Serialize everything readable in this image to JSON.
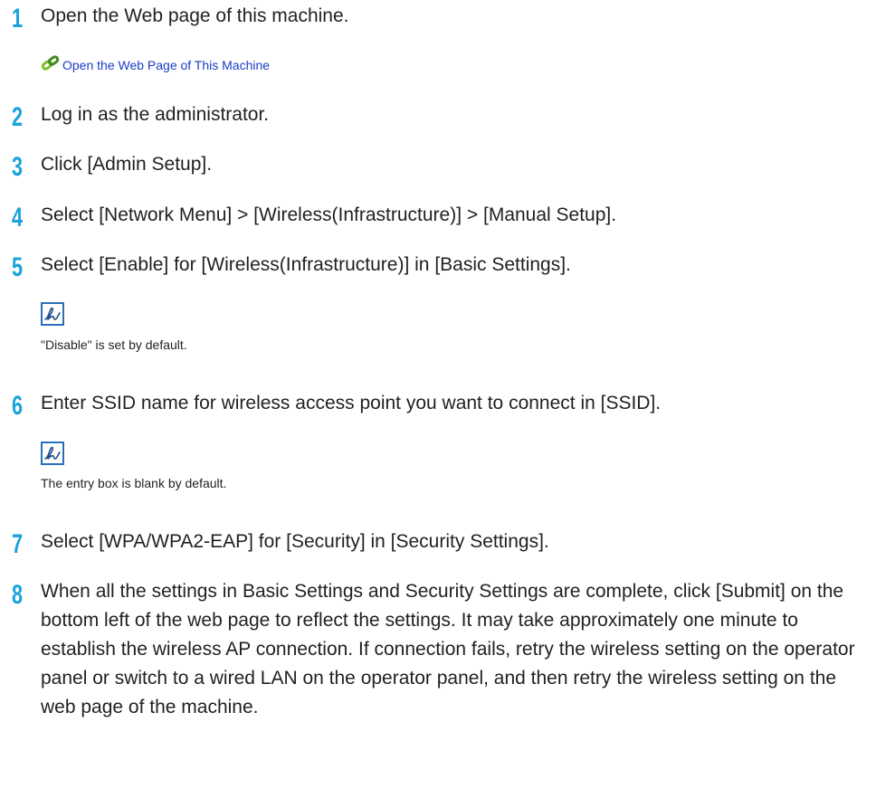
{
  "steps": [
    {
      "number": "1",
      "text": "Open the Web page of this machine."
    },
    {
      "number": "2",
      "text": "Log in as the administrator."
    },
    {
      "number": "3",
      "text": "Click [Admin Setup]."
    },
    {
      "number": "4",
      "text": "Select [Network Menu] > [Wireless(Infrastructure)] > [Manual Setup]."
    },
    {
      "number": "5",
      "text": "Select [Enable] for [Wireless(Infrastructure)] in [Basic Settings]."
    },
    {
      "number": "6",
      "text": "Enter SSID name for wireless access point you want to connect in [SSID]."
    },
    {
      "number": "7",
      "text": "Select [WPA/WPA2-EAP] for [Security] in [Security Settings]."
    },
    {
      "number": "8",
      "text": "When all the settings in Basic Settings and Security Settings are complete, click [Submit] on the bottom left of the web page to reflect the settings. It may take approximately one minute to establish the wireless AP connection. If connection fails, retry the wireless setting on the operator panel or switch to a wired LAN on the operator panel, and then retry the wireless setting on the web page of the machine."
    }
  ],
  "links": {
    "open_web_page": "Open the Web Page of This Machine"
  },
  "notes": {
    "step5": "\"Disable\" is set by default.",
    "step6": "The entry box is blank by default."
  },
  "colors": {
    "step_number": "#1aa2dc",
    "link": "#1a3cc8",
    "note_icon": "#2a6fba"
  },
  "icons": {
    "link": "chain-link-icon",
    "note": "memo-pen-icon"
  }
}
